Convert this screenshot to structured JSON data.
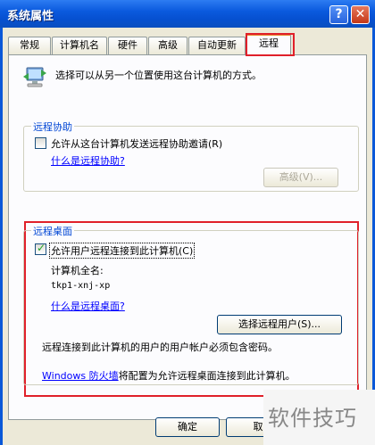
{
  "window": {
    "title": "系统属性",
    "help_button": "?",
    "close_button": "✕"
  },
  "tabs": [
    {
      "label": "常规"
    },
    {
      "label": "计算机名"
    },
    {
      "label": "硬件"
    },
    {
      "label": "高级"
    },
    {
      "label": "自动更新"
    },
    {
      "label": "远程"
    }
  ],
  "intro": {
    "text": "选择可以从另一个位置使用这台计算机的方式。"
  },
  "remote_assistance": {
    "legend": "远程协助",
    "checkbox_label": "允许从这台计算机发送远程协助邀请",
    "checkbox_shortcut": "(R)",
    "checked": false,
    "link": "什么是远程协助?",
    "advanced_button": "高级(V)..."
  },
  "remote_desktop": {
    "legend": "远程桌面",
    "checkbox_label": "允许用户远程连接到此计算机",
    "checkbox_shortcut": "(C)",
    "checked": true,
    "full_name_label": "计算机全名:",
    "full_name_value": "tkp1-xnj-xp",
    "link": "什么是远程桌面?",
    "select_users_button": "选择远程用户(S)...",
    "note": "远程连接到此计算机的用户的用户帐户必须包含密码。",
    "firewall_link": "Windows 防火墙",
    "firewall_text": "将配置为允许远程桌面连接到此计算机。"
  },
  "footer": {
    "ok_button": "确定",
    "cancel_button": "取"
  },
  "watermark": "软件技巧"
}
